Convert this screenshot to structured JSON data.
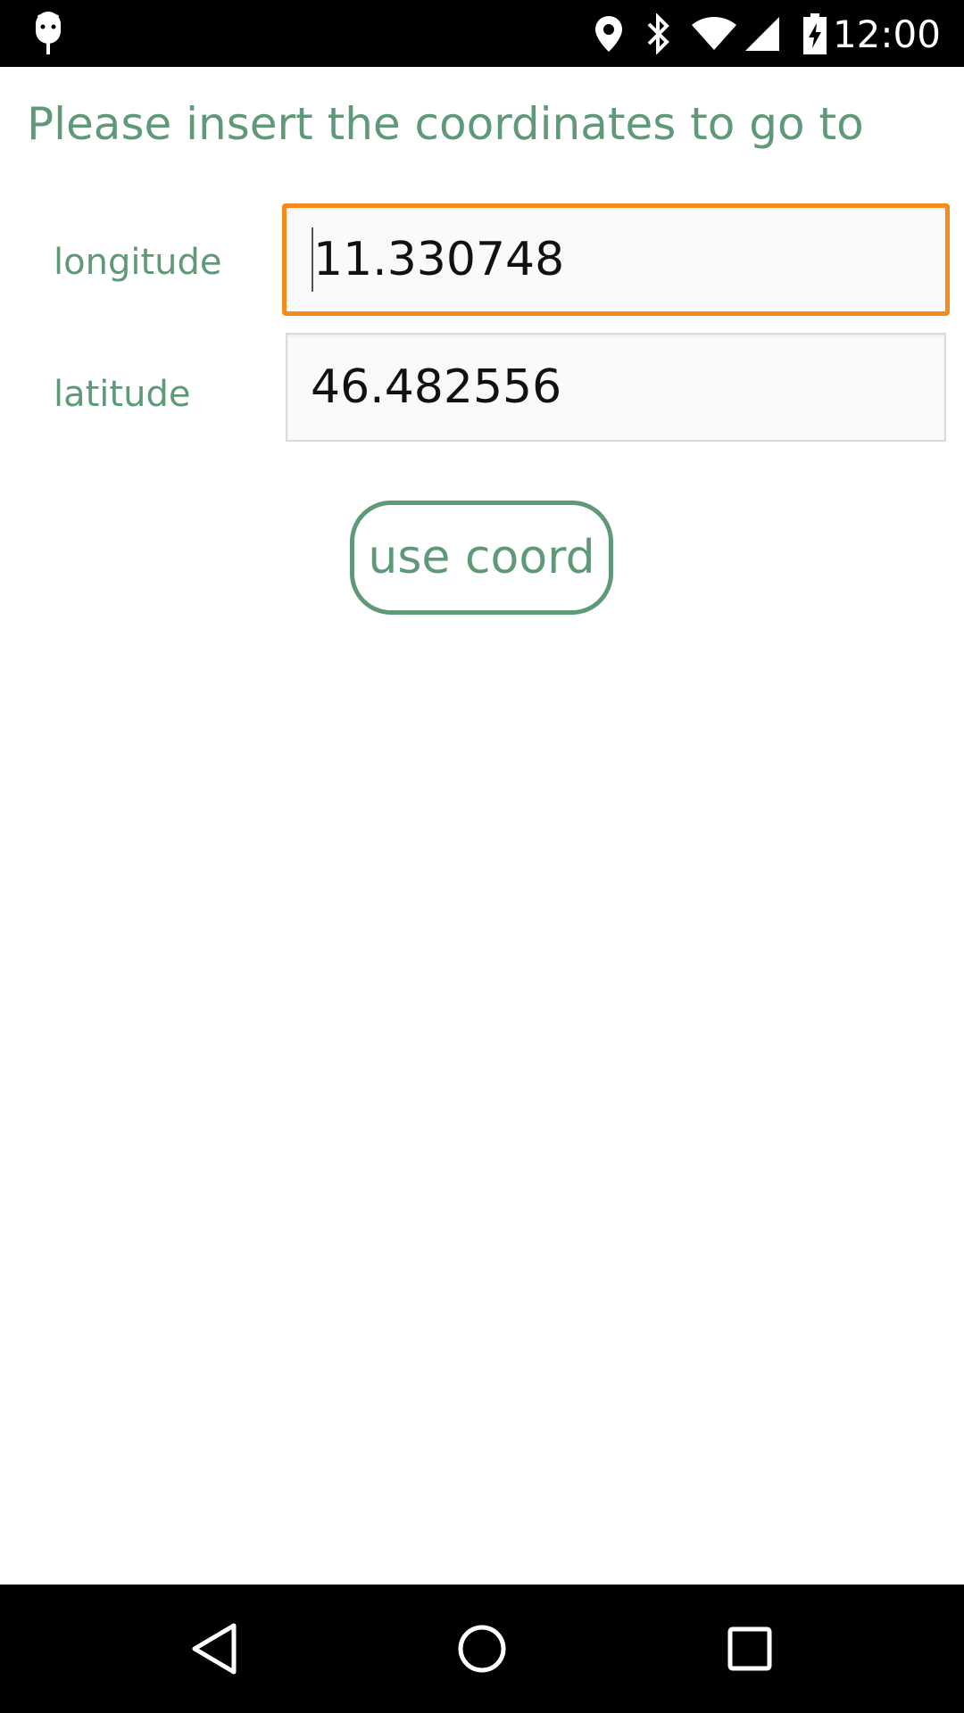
{
  "status_bar": {
    "time": "12:00",
    "icons": [
      "android-debug-icon",
      "location-pin-icon",
      "bluetooth-icon",
      "wifi-icon",
      "cell-signal-icon",
      "battery-charging-icon"
    ]
  },
  "main": {
    "title": "Please insert the coordinates to go to",
    "fields": [
      {
        "label": "longitude",
        "value": "11.330748",
        "focused": true
      },
      {
        "label": "latitude",
        "value": "46.482556",
        "focused": false
      }
    ],
    "button_label": "use coord"
  },
  "nav_bar": {
    "icons": [
      "back-icon",
      "home-icon",
      "recents-icon"
    ]
  },
  "colors": {
    "accent_green": "#5f9a78",
    "focus_orange": "#f68a1c",
    "bars": "#000000"
  }
}
